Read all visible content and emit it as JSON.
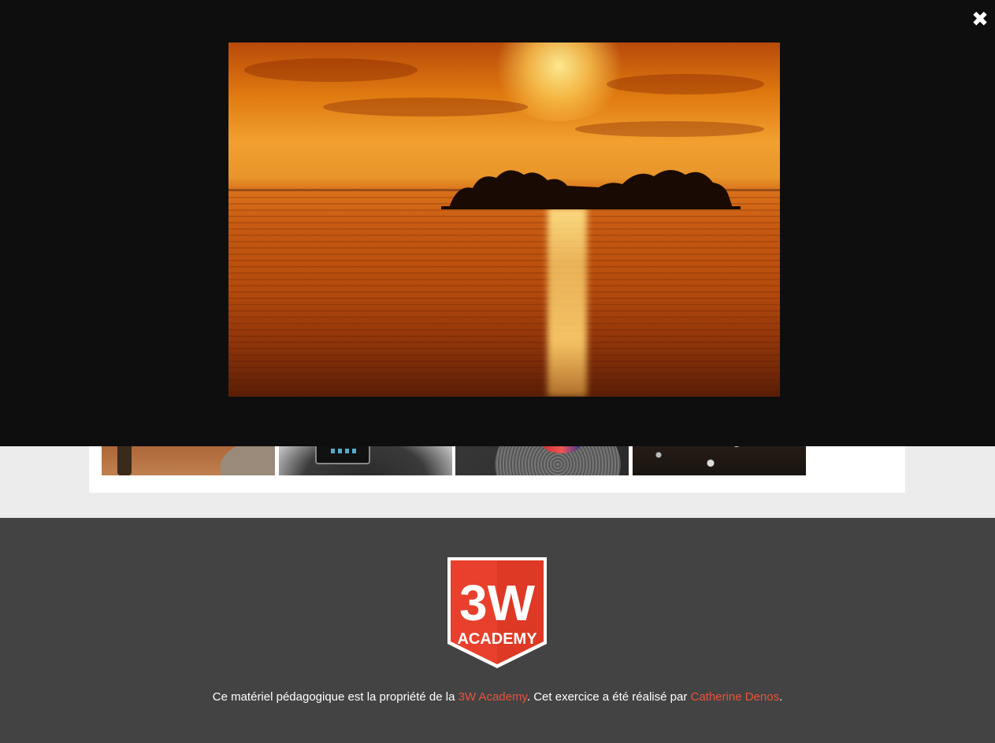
{
  "lightbox": {
    "close_icon": "close-icon",
    "close_glyph": "✖",
    "image_subject": "sunset-over-lake-island"
  },
  "gallery": {
    "thumbnails": [
      {
        "subject": "autumn-park"
      },
      {
        "subject": "tablet-in-hands"
      },
      {
        "subject": "turntable"
      },
      {
        "subject": "bokeh-lights"
      }
    ]
  },
  "footer": {
    "logo": {
      "big_text": "3W",
      "small_text": "ACADEMY",
      "color": "#e8402c"
    },
    "text_before": "Ce matériel pédagogique est la propriété de la ",
    "link_academy": "3W Academy",
    "text_middle": ". Cet exercice a été réalisé par ",
    "link_author": "Catherine Denos",
    "text_after": ".",
    "link_color": "#e8533a"
  }
}
